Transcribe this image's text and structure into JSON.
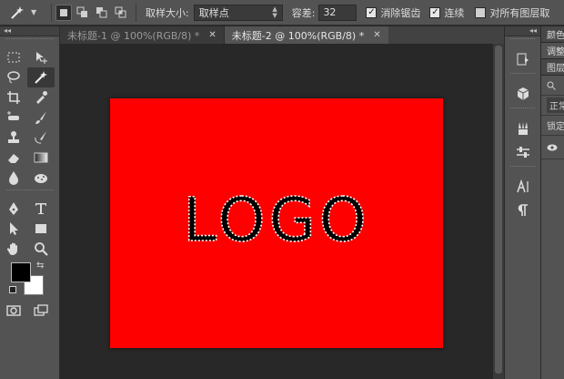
{
  "options_bar": {
    "sample_size_label": "取样大小:",
    "sample_size_value": "取样点",
    "tolerance_label": "容差:",
    "tolerance_value": "32",
    "antialias_label": "消除锯齿",
    "antialias_checked": true,
    "contiguous_label": "连续",
    "contiguous_checked": true,
    "all_layers_label": "对所有图层取",
    "all_layers_checked": false
  },
  "tabs": [
    {
      "label": "未标题-1 @ 100%(RGB/8) *",
      "active": false
    },
    {
      "label": "未标题-2 @ 100%(RGB/8) *",
      "active": true
    }
  ],
  "canvas": {
    "background_color": "#ff0000",
    "text": "LOGO",
    "text_color": "#000000"
  },
  "panels": {
    "color_tab": "颜色",
    "adjust_tab": "调整",
    "layers_tab": "图层",
    "search_icon": "search-icon",
    "blend_mode": "正常",
    "lock_label": "锁定"
  },
  "colors": {
    "foreground": "#000000",
    "background": "#ffffff"
  }
}
